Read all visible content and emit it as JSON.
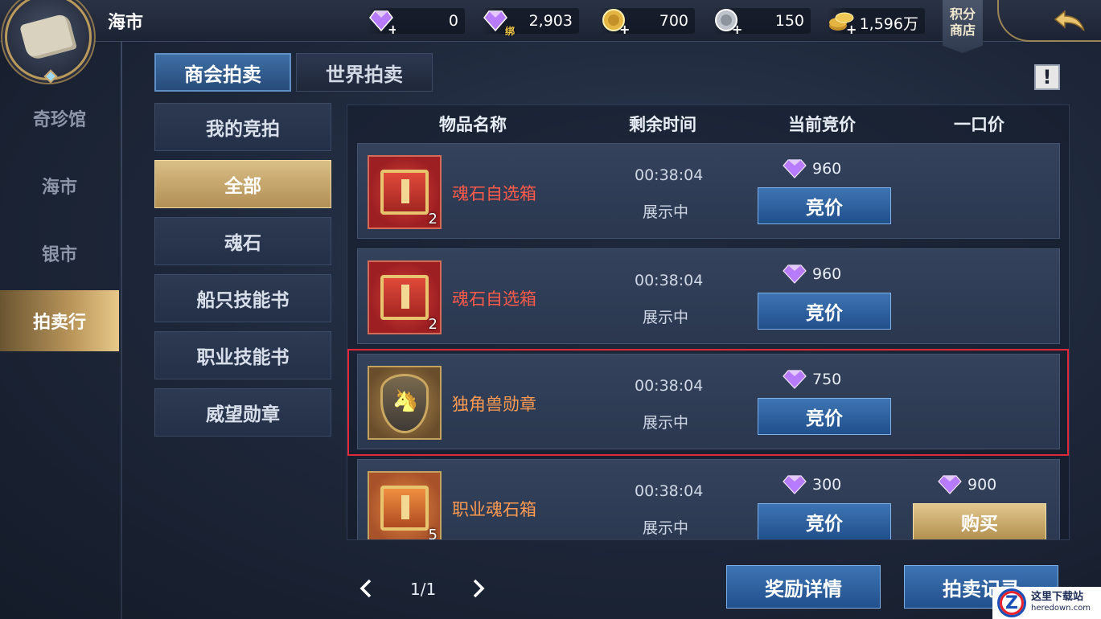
{
  "header": {
    "title": "海市",
    "currencies": [
      {
        "icon": "purple-diamond-icon",
        "value": "0"
      },
      {
        "icon": "bound-purple-diamond-icon",
        "value": "2,903",
        "tag": "绑"
      },
      {
        "icon": "gold-coin-icon",
        "value": "700"
      },
      {
        "icon": "silver-coin-icon",
        "value": "150"
      },
      {
        "icon": "gold-coin-stack-icon",
        "value": "1,596万"
      }
    ],
    "shop_label": "积分商店"
  },
  "left_nav": {
    "items": [
      {
        "label": "奇珍馆",
        "active": false
      },
      {
        "label": "海市",
        "active": false
      },
      {
        "label": "银市",
        "active": false
      },
      {
        "label": "拍卖行",
        "active": true
      }
    ]
  },
  "tabs": [
    {
      "label": "商会拍卖",
      "active": true
    },
    {
      "label": "世界拍卖",
      "active": false
    }
  ],
  "info_label": "!",
  "categories": [
    {
      "label": "我的竞拍",
      "active": false
    },
    {
      "label": "全部",
      "active": true
    },
    {
      "label": "魂石",
      "active": false
    },
    {
      "label": "船只技能书",
      "active": false
    },
    {
      "label": "职业技能书",
      "active": false
    },
    {
      "label": "威望勋章",
      "active": false
    }
  ],
  "table": {
    "headers": [
      "物品名称",
      "剩余时间",
      "当前竞价",
      "一口价"
    ],
    "rows": [
      {
        "name": "魂石自选箱",
        "qty": "2",
        "time": "00:38:04",
        "status": "展示中",
        "bid": "960",
        "buyout": "",
        "bid_label": "竞价",
        "buy_label": ""
      },
      {
        "name": "魂石自选箱",
        "qty": "2",
        "time": "00:38:04",
        "status": "展示中",
        "bid": "960",
        "buyout": "",
        "bid_label": "竞价",
        "buy_label": ""
      },
      {
        "name": "独角兽勋章",
        "qty": "",
        "time": "00:38:04",
        "status": "展示中",
        "bid": "750",
        "buyout": "",
        "bid_label": "竞价",
        "buy_label": ""
      },
      {
        "name": "职业魂石箱",
        "qty": "5",
        "time": "00:38:04",
        "status": "展示中",
        "bid": "300",
        "buyout": "900",
        "bid_label": "竞价",
        "buy_label": "购买"
      }
    ]
  },
  "pager": {
    "text": "1/1"
  },
  "bottom_buttons": {
    "reward": "奖励详情",
    "record": "拍卖记录"
  },
  "watermark": {
    "cn": "这里下载站",
    "en": "heredown.com",
    "logo": "Z"
  },
  "colors": {
    "accent_blue": "#2f62a0",
    "gold": "#c9a86a",
    "item_red": "#ff5a4a",
    "item_orange": "#ff9a52",
    "highlight": "#e0283a"
  }
}
